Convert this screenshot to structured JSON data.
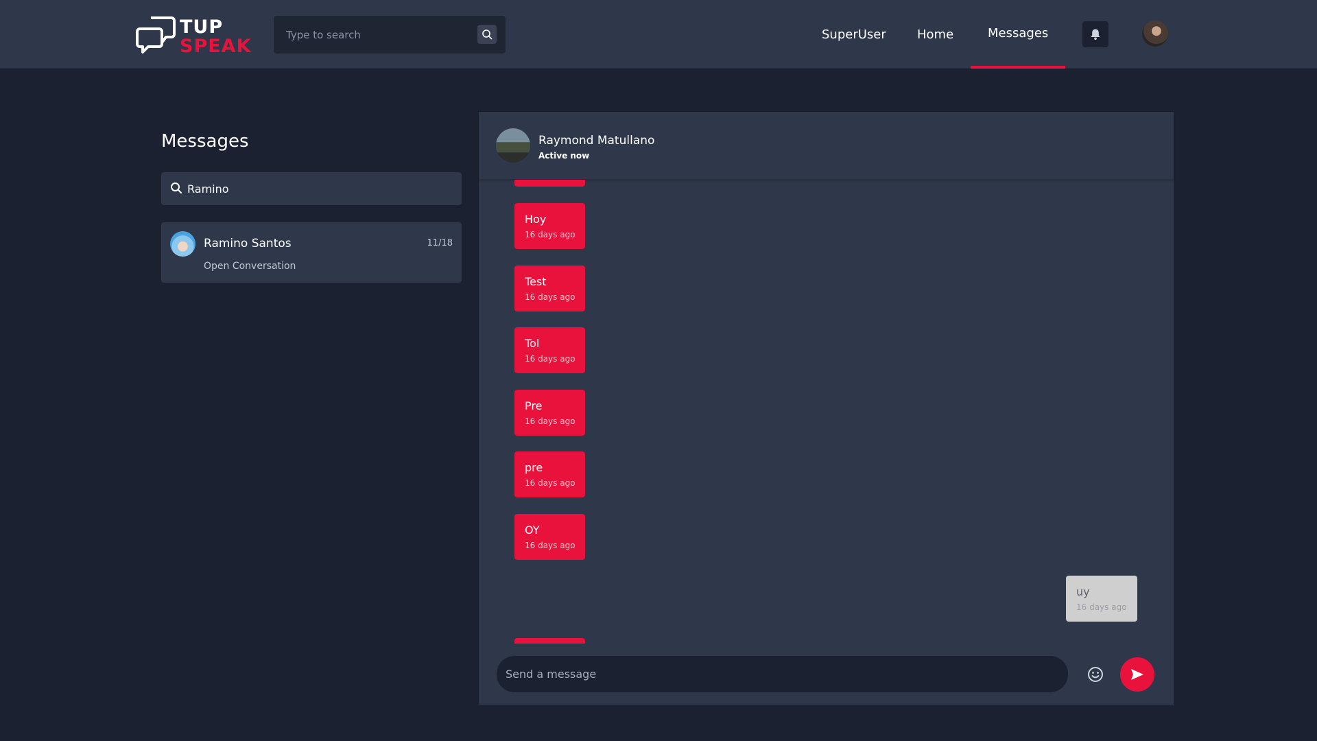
{
  "brand": {
    "name_line1": "TUP",
    "name_line2": "SPEAK",
    "accent_color": "#e8123c"
  },
  "header": {
    "search_placeholder": "Type to search",
    "nav": [
      {
        "label": "SuperUser",
        "active": false
      },
      {
        "label": "Home",
        "active": false
      },
      {
        "label": "Messages",
        "active": true
      }
    ],
    "icons": {
      "search": "search-icon",
      "notifications": "bell-icon",
      "profile": "avatar"
    }
  },
  "sidebar": {
    "title": "Messages",
    "search_value": "Ramino",
    "conversations": [
      {
        "name": "Ramino Santos",
        "date": "11/18",
        "subtitle": "Open Conversation"
      }
    ]
  },
  "chat": {
    "contact_name": "Raymond Matullano",
    "status": "Active now",
    "messages": [
      {
        "text": "Hoy",
        "time": "16 days ago",
        "direction": "incoming"
      },
      {
        "text": "Test",
        "time": "16 days ago",
        "direction": "incoming"
      },
      {
        "text": "Tol",
        "time": "16 days ago",
        "direction": "incoming"
      },
      {
        "text": "Pre",
        "time": "16 days ago",
        "direction": "incoming"
      },
      {
        "text": "pre",
        "time": "16 days ago",
        "direction": "incoming"
      },
      {
        "text": "OY",
        "time": "16 days ago",
        "direction": "incoming"
      },
      {
        "text": "uy",
        "time": "16 days ago",
        "direction": "outgoing"
      }
    ],
    "composer_placeholder": "Send a message",
    "icons": {
      "emoji": "emoji-icon",
      "send": "send-icon"
    }
  }
}
